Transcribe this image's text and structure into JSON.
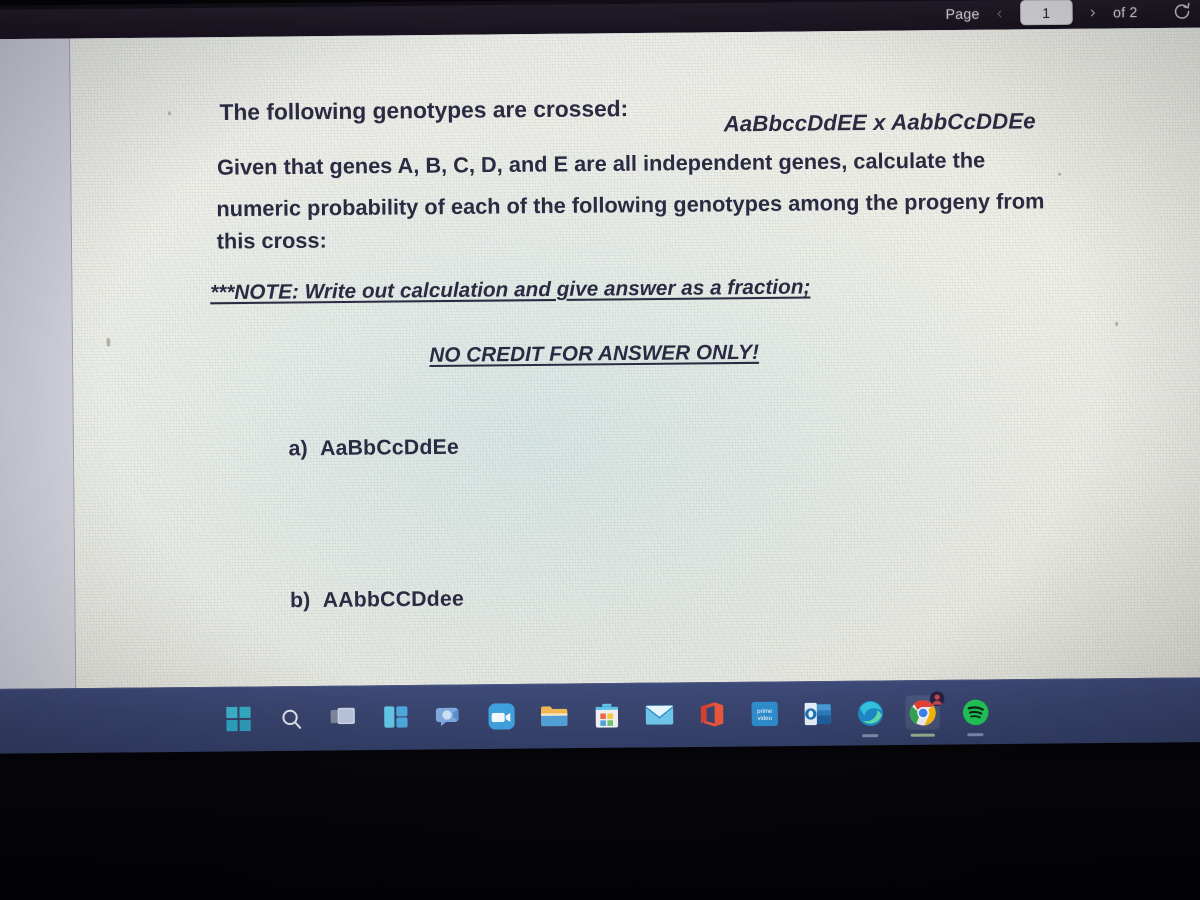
{
  "viewer_toolbar": {
    "page_label": "Page",
    "prev_arrow": "‹",
    "page_number_value": "1",
    "next_arrow": "›",
    "of_label": "of 2",
    "reload_icon_name": "reload-icon"
  },
  "document": {
    "intro_line": "The following genotypes are crossed:",
    "cross_expression": "AaBbccDdEE x AabbCcDDEe",
    "given_line_1": "Given that genes A, B, C, D, and E are all independent genes, calculate the",
    "given_line_2": "numeric probability of each of the following genotypes among the progeny from",
    "given_line_3": "this cross:",
    "note_line_1": "***NOTE:  Write out calculation and give answer as a fraction;",
    "note_line_2": "NO CREDIT FOR ANSWER ONLY!",
    "items": [
      {
        "letter": "a)",
        "genotype": "AaBbCcDdEe"
      },
      {
        "letter": "b)",
        "genotype": "AAbbCCDdee"
      }
    ]
  },
  "taskbar": {
    "items": [
      {
        "name": "start-button",
        "label": "Start"
      },
      {
        "name": "search-icon",
        "label": "Search"
      },
      {
        "name": "task-view-icon",
        "label": "Task View"
      },
      {
        "name": "widgets-icon",
        "label": "Widgets"
      },
      {
        "name": "chat-teams-icon",
        "label": "Chat"
      },
      {
        "name": "zoom-icon",
        "label": "Zoom"
      },
      {
        "name": "file-explorer-icon",
        "label": "File Explorer"
      },
      {
        "name": "microsoft-store-icon",
        "label": "Microsoft Store"
      },
      {
        "name": "mail-icon",
        "label": "Mail"
      },
      {
        "name": "office-icon",
        "label": "Office"
      },
      {
        "name": "prime-video-icon",
        "label": "Prime Video"
      },
      {
        "name": "outlook-icon",
        "label": "Outlook"
      },
      {
        "name": "edge-icon",
        "label": "Microsoft Edge"
      },
      {
        "name": "chrome-icon",
        "label": "Google Chrome"
      },
      {
        "name": "spotify-icon",
        "label": "Spotify"
      }
    ],
    "prime_video_text": "prime video"
  },
  "colors": {
    "toolbar_bg": "#1d1823",
    "taskbar_bg": "#39456f",
    "page_bg": "#eeede8",
    "text": "#2c2b43",
    "gutter": "#c8c9d4"
  }
}
